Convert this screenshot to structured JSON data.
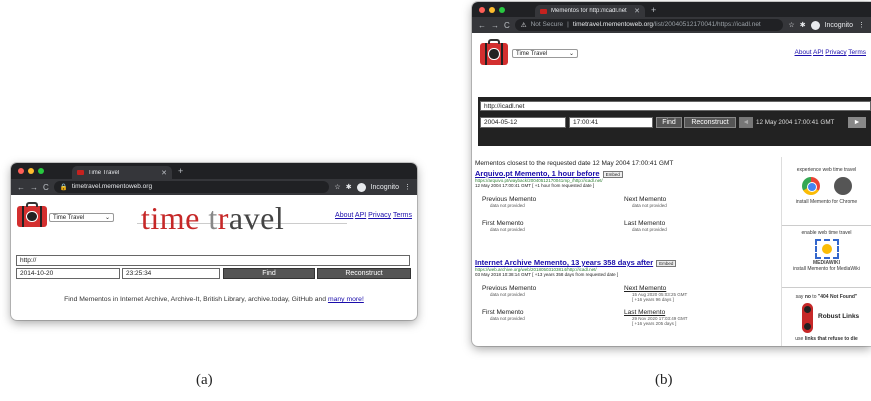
{
  "a": {
    "tab_title": "Time Travel",
    "url": "timetravel.mementoweb.org",
    "incognito": "Incognito",
    "select_value": "Time Travel",
    "links": [
      "About",
      "API",
      "Privacy",
      "Terms"
    ],
    "title": {
      "p1": "time",
      "p2": " t",
      "p3": "r",
      "p4": "avel"
    },
    "url_value": "http://",
    "date": "2014-10-20",
    "time": "23:25:34",
    "find": "Find",
    "reconstruct": "Reconstruct",
    "footer_text": "Find Mementos in Internet Archive, Archive-It, British Library, archive.today, GitHub and ",
    "footer_link": "many more!"
  },
  "b": {
    "tab_title": "Mementos for http://icadl.net",
    "not_secure": "Not Secure",
    "url_host": "timetravel.mementoweb.org",
    "url_path": "/list/20040512170041/https://icadl.net",
    "incognito": "Incognito",
    "select_value": "Time Travel",
    "links": [
      "About",
      "API",
      "Privacy",
      "Terms"
    ],
    "url_value": "http://icadl.net",
    "date": "2004-05-12",
    "time": "17:00:41",
    "find": "Find",
    "reconstruct": "Reconstruct",
    "prev_arrow": "◄",
    "next_arrow": "►",
    "current_datetime": "12 May 2004 17:00:41 GMT",
    "heading": "Mementos closest to the requested date 12 May 2004 17:00:41 GMT",
    "embed": "Embed",
    "m1": {
      "title": "Arquivo.pt Memento, 1 hour before",
      "url": "https://arquivo.pt/wayback/20040512170041mp_/http://icadl.net/",
      "date": "12 May 2004 17:00:41 GMT",
      "delta": "[ +1 hour from requested date ]",
      "prev_label": "Previous Memento",
      "prev_val": "data not provided",
      "next_label": "Next Memento",
      "next_val": "data not provided",
      "first_label": "First Memento",
      "first_val": "data not provided",
      "last_label": "Last Memento",
      "last_val": "data not provided"
    },
    "m2": {
      "title": "Internet Archive Memento, 13 years 358 days after",
      "url": "https://web.archive.org/web/20180503103814/http://icadl.net/",
      "date": "03 May 2018 10:38:14 GMT",
      "delta": "[ +13 years 358 days from requested date ]",
      "prev_label": "Previous Memento",
      "prev_val": "data not provided",
      "next_label": "Next Memento",
      "next_date": "15 Aug 2020 05:03:25 GMT",
      "next_delta": "[ +16 years 96 days ]",
      "first_label": "First Memento",
      "first_val": "data not provided",
      "last_label": "Last Memento",
      "last_date": "29 Nov 2020 17:03:49 GMT",
      "last_delta": "[ +16 years 205 days ]"
    },
    "side": {
      "experience": "experience web time travel",
      "install_chrome": "install Memento for Chrome",
      "enable": "enable web time travel",
      "mediawiki": "MEDIAWIKI",
      "install_mw": "install Memento for MediaWiki",
      "say_no_prefix": "say ",
      "say_no_bold": "no",
      "say_no_mid": " to ",
      "say_no_quote": "\"404 Not Found\"",
      "robust": "Robust Links",
      "use_prefix": "use ",
      "use_bold": "links that refuse to die"
    }
  },
  "captions": {
    "a": "(a)",
    "b": "(b)"
  },
  "colors": {
    "chrome_dark": "#202124",
    "toolbar": "#35363a",
    "luggage_red": "#d32f2f",
    "link": "#1a0dab",
    "button": "#555555"
  }
}
